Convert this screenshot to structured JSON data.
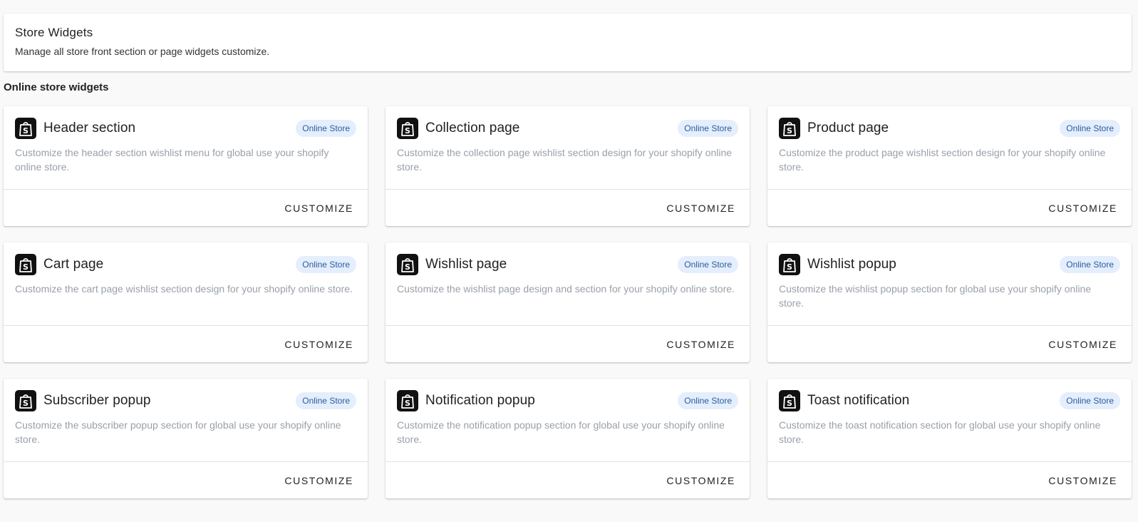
{
  "header": {
    "title": "Store Widgets",
    "subtitle": "Manage all store front section or page widgets customize."
  },
  "section_title": "Online store widgets",
  "widgets": [
    {
      "title": "Header section",
      "badge": "Online Store",
      "description": "Customize the header section wishlist menu for global use your shopify online store.",
      "button": "CUSTOMIZE",
      "icon": "shopify-bag-icon"
    },
    {
      "title": "Collection page",
      "badge": "Online Store",
      "description": "Customize the collection page wishlist section design for your shopify online store.",
      "button": "CUSTOMIZE",
      "icon": "shopify-bag-icon"
    },
    {
      "title": "Product page",
      "badge": "Online Store",
      "description": "Customize the product page wishlist section design for your shopify online store.",
      "button": "CUSTOMIZE",
      "icon": "shopify-bag-icon"
    },
    {
      "title": "Cart page",
      "badge": "Online Store",
      "description": "Customize the cart page wishlist section design for your shopify online store.",
      "button": "CUSTOMIZE",
      "icon": "shopify-bag-icon"
    },
    {
      "title": "Wishlist page",
      "badge": "Online Store",
      "description": "Customize the wishlist page design and section for your shopify online store.",
      "button": "CUSTOMIZE",
      "icon": "shopify-bag-icon"
    },
    {
      "title": "Wishlist popup",
      "badge": "Online Store",
      "description": "Customize the wishlist popup section for global use your shopify online store.",
      "button": "CUSTOMIZE",
      "icon": "shopify-bag-icon"
    },
    {
      "title": "Subscriber popup",
      "badge": "Online Store",
      "description": "Customize the subscriber popup section for global use your shopify online store.",
      "button": "CUSTOMIZE",
      "icon": "shopify-bag-icon"
    },
    {
      "title": "Notification popup",
      "badge": "Online Store",
      "description": "Customize the notification popup section for global use your shopify online store.",
      "button": "CUSTOMIZE",
      "icon": "shopify-bag-icon"
    },
    {
      "title": "Toast notification",
      "badge": "Online Store",
      "description": "Customize the toast notification section for global use your shopify online store.",
      "button": "CUSTOMIZE",
      "icon": "shopify-bag-icon"
    }
  ],
  "colors": {
    "badge_bg": "#e4eefc",
    "badge_text": "#2b5c9e",
    "icon_bg": "#111111"
  }
}
